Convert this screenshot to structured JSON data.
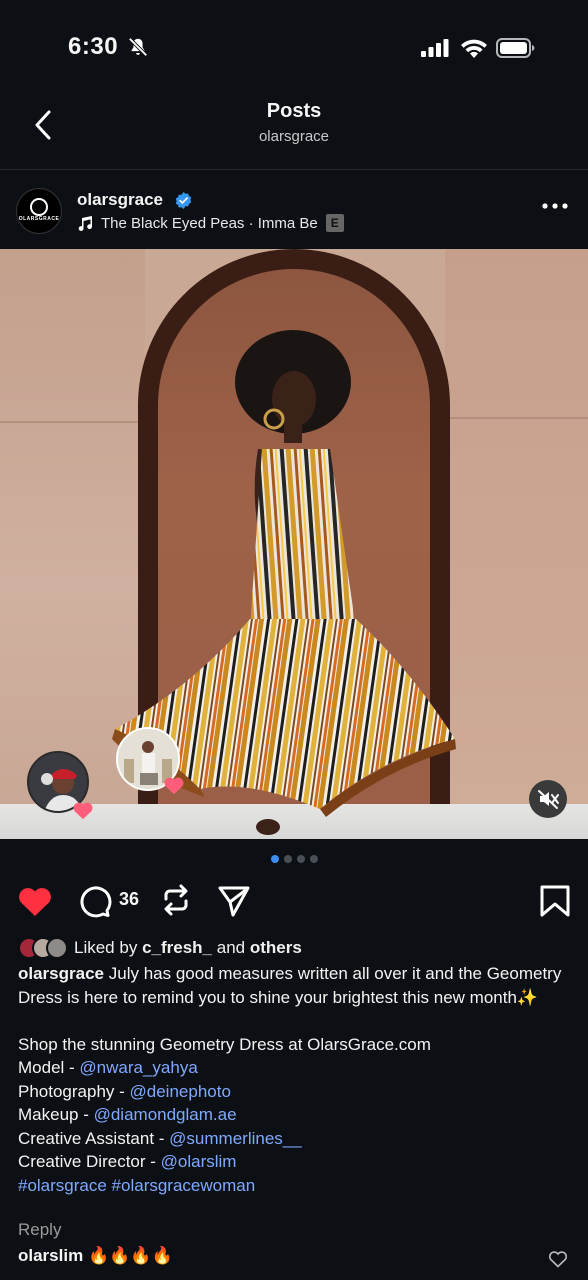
{
  "status_bar": {
    "time": "6:30"
  },
  "header": {
    "title": "Posts",
    "subtitle": "olarsgrace"
  },
  "post": {
    "username": "olarsgrace",
    "avatar_text": "OLARSGRACE",
    "music": "The Black Eyed Peas · Imma Be",
    "explicit": "E",
    "media_dots": 4,
    "active_dot": 0,
    "comment_count": "36"
  },
  "likes": {
    "prefix": "Liked by",
    "user": "c_fresh_",
    "middle": "and",
    "others": "others"
  },
  "caption": {
    "username": "olarsgrace",
    "line1": "July has good measures written all over it and the Geometry Dress is here to remind you to shine your brightest this new month✨",
    "shop": "Shop the stunning Geometry Dress at OlarsGrace.com",
    "credits": [
      {
        "label": "Model - ",
        "handle": "@nwara_yahya"
      },
      {
        "label": "Photography - ",
        "handle": "@deinephoto"
      },
      {
        "label": "Makeup - ",
        "handle": "@diamondglam.ae"
      },
      {
        "label": "Creative Assistant - ",
        "handle": "@summerlines__"
      },
      {
        "label": "Creative Director - ",
        "handle": "@olarslim"
      }
    ],
    "hashtags": "#olarsgrace #olarsgracewoman"
  },
  "reply_label": "Reply",
  "top_comment": {
    "username": "olarslim",
    "text": "🔥🔥🔥🔥"
  },
  "colors": {
    "background": "#0c1014",
    "like": "#ff3040",
    "link": "#7fa8ff",
    "verified": "#3797f0"
  }
}
